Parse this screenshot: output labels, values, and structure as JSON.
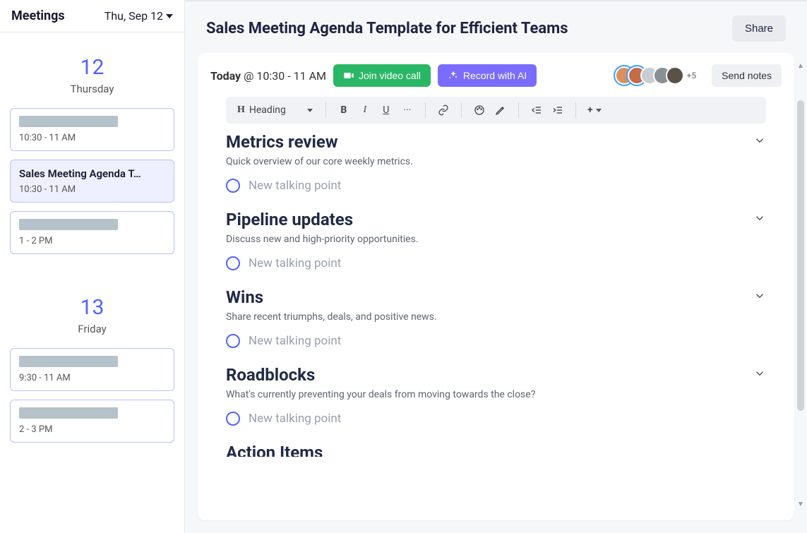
{
  "sidebar": {
    "title": "Meetings",
    "datePicker": "Thu, Sep 12",
    "days": [
      {
        "number": "12",
        "name": "Thursday",
        "events": [
          {
            "title": "",
            "time": "10:30 - 11 AM",
            "placeholder": true,
            "selected": false
          },
          {
            "title": "Sales Meeting Agenda T…",
            "time": "10:30 - 11 AM",
            "placeholder": false,
            "selected": true
          },
          {
            "title": "",
            "time": "1 - 2 PM",
            "placeholder": true,
            "selected": false
          }
        ]
      },
      {
        "number": "13",
        "name": "Friday",
        "events": [
          {
            "title": "",
            "time": "9:30 - 11 AM",
            "placeholder": true,
            "selected": false
          },
          {
            "title": "",
            "time": "2 - 3 PM",
            "placeholder": true,
            "selected": false
          }
        ]
      }
    ]
  },
  "main": {
    "pageTitle": "Sales Meeting Agenda Template for Efficient Teams",
    "shareLabel": "Share",
    "todayStrong": "Today",
    "todayRest": " @ 10:30 - 11 AM",
    "joinLabel": "Join video call",
    "recordLabel": "Record with AI",
    "sendNotesLabel": "Send notes",
    "avatarExtra": "+5",
    "avatarColors": [
      "#d98f5f",
      "#c46b4a",
      "#c9ccd1",
      "#8a8f96",
      "#5a5148"
    ],
    "toolbar": {
      "headingLabel": "Heading"
    },
    "sections": [
      {
        "title": "Metrics review",
        "desc": "Quick overview of our core weekly metrics.",
        "tp": "New talking point"
      },
      {
        "title": "Pipeline updates",
        "desc": "Discuss new and high-priority opportunities.",
        "tp": "New talking point"
      },
      {
        "title": "Wins",
        "desc": "Share recent triumphs, deals, and positive news.",
        "tp": "New talking point"
      },
      {
        "title": "Roadblocks",
        "desc": "What's currently preventing your deals from moving towards the close?",
        "tp": "New talking point"
      }
    ],
    "partialSection": "Action Items"
  }
}
